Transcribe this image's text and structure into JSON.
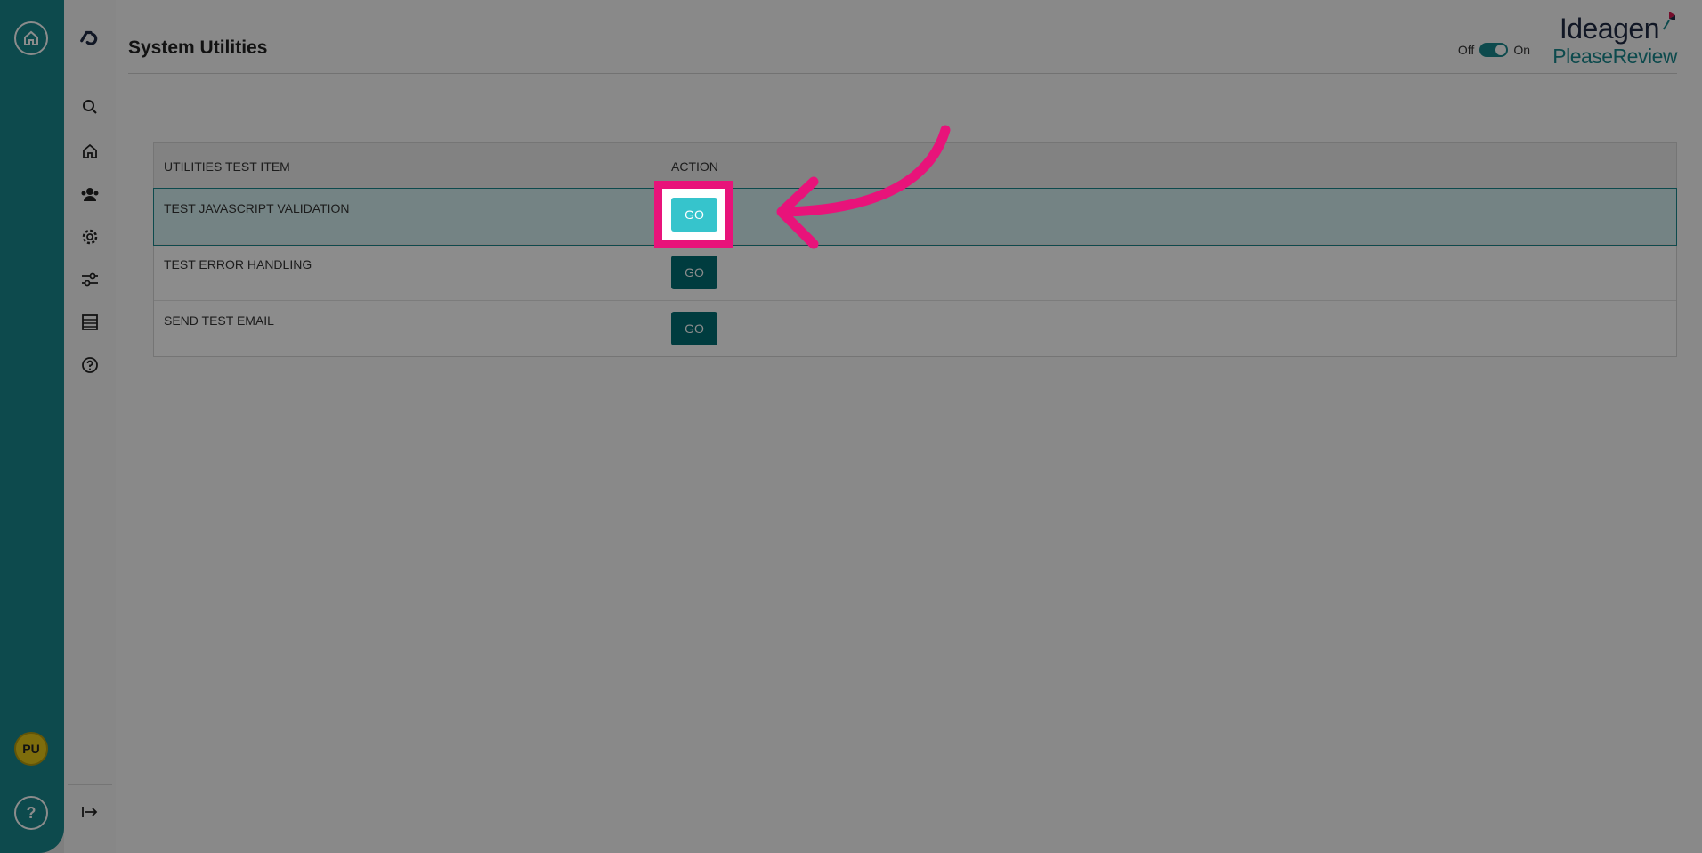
{
  "rail": {
    "user_initials": "PU",
    "help_label": "?"
  },
  "page": {
    "title": "System Utilities"
  },
  "toggle": {
    "off_label": "Off",
    "on_label": "On",
    "state": "on"
  },
  "brand": {
    "line1": "Ideagen",
    "line2": "PleaseReview"
  },
  "table": {
    "headers": [
      "UTILITIES TEST ITEM",
      "ACTION"
    ],
    "rows": [
      {
        "name": "TEST JAVASCRIPT VALIDATION",
        "action": "GO",
        "selected": true
      },
      {
        "name": "TEST ERROR HANDLING",
        "action": "GO",
        "selected": false
      },
      {
        "name": "SEND TEST EMAIL",
        "action": "GO",
        "selected": false
      }
    ]
  },
  "colors": {
    "accent": "#18888c",
    "highlight": "#e8137a",
    "button": "#006e73",
    "button_active": "#36c4cc"
  }
}
